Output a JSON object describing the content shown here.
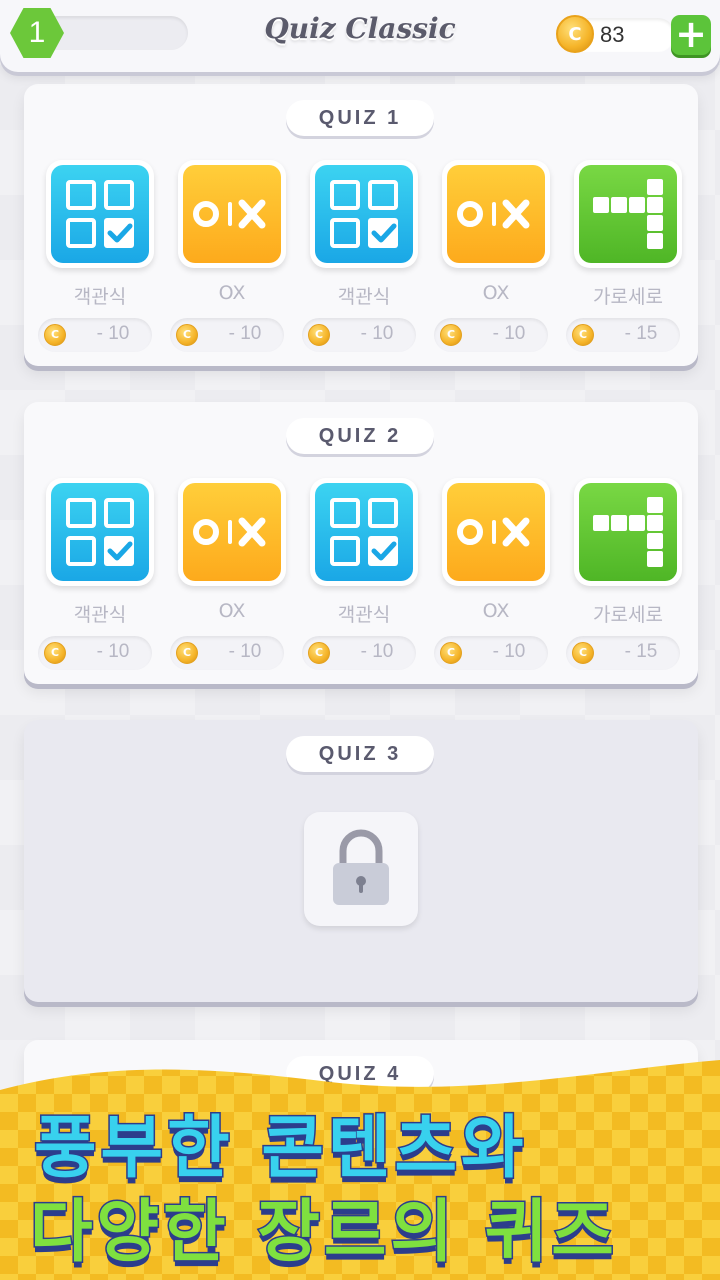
{
  "header": {
    "level": "1",
    "title": "Quiz Classic",
    "coins": "83",
    "add_label": "+",
    "coin_symbol": "C"
  },
  "quizzes": [
    {
      "title": "QUIZ 1",
      "locked": false,
      "games": [
        {
          "type": "multiple-choice",
          "label": "객관식",
          "cost": "- 10"
        },
        {
          "type": "ox",
          "label": "OX",
          "cost": "- 10"
        },
        {
          "type": "multiple-choice",
          "label": "객관식",
          "cost": "- 10"
        },
        {
          "type": "ox",
          "label": "OX",
          "cost": "- 10"
        },
        {
          "type": "crossword",
          "label": "가로세로",
          "cost": "- 15"
        }
      ]
    },
    {
      "title": "QUIZ 2",
      "locked": false,
      "games": [
        {
          "type": "multiple-choice",
          "label": "객관식",
          "cost": "- 10"
        },
        {
          "type": "ox",
          "label": "OX",
          "cost": "- 10"
        },
        {
          "type": "multiple-choice",
          "label": "객관식",
          "cost": "- 10"
        },
        {
          "type": "ox",
          "label": "OX",
          "cost": "- 10"
        },
        {
          "type": "crossword",
          "label": "가로세로",
          "cost": "- 15"
        }
      ]
    },
    {
      "title": "QUIZ 3",
      "locked": true,
      "games": []
    },
    {
      "title": "QUIZ 4",
      "locked": false,
      "games": []
    }
  ],
  "promo": {
    "line1": "풍부한 콘텐츠와",
    "line2": "다양한 장르의 퀴즈"
  },
  "colors": {
    "blue_tile": "#1aa7e6",
    "yellow_tile": "#fdaa1c",
    "green_tile": "#4fb626",
    "promo_bg": "#f7c52a",
    "promo_line1": "#38d1ee",
    "promo_line2": "#7fe03f"
  },
  "icons": {
    "multiple-choice": "checkbox-grid-icon",
    "ox": "ox-icon",
    "crossword": "crossword-icon",
    "locked": "padlock-icon",
    "coin": "coin-icon",
    "add": "plus-icon"
  }
}
